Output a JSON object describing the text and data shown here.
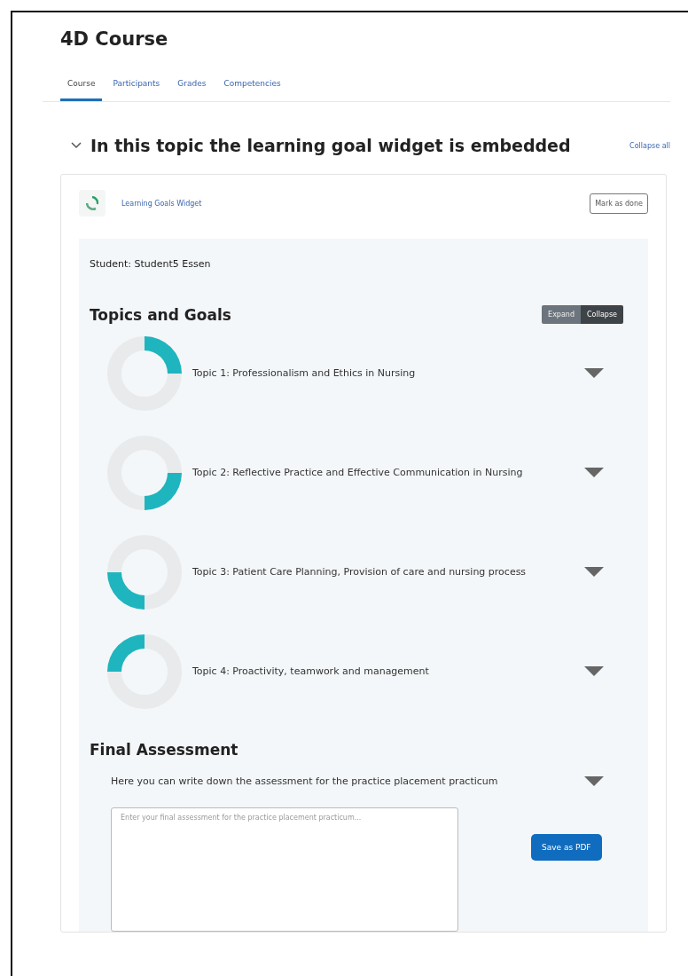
{
  "course_title": "4D Course",
  "tabs": [
    {
      "label": "Course",
      "selected": true
    },
    {
      "label": "Participants",
      "selected": false
    },
    {
      "label": "Grades",
      "selected": false
    },
    {
      "label": "Competencies",
      "selected": false
    }
  ],
  "section": {
    "title": "In this topic the learning goal widget is embedded",
    "expanded": true,
    "collapse_all": "Collapse all"
  },
  "activity": {
    "name": "Learning Goals Widget",
    "mark_button": "Mark as done"
  },
  "student": "Student: Student5 Essen",
  "topics_heading": "Topics and Goals",
  "toggle_buttons": [
    {
      "label": "Expand",
      "selected": false
    },
    {
      "label": "Collapse",
      "selected": true
    }
  ],
  "topics": [
    {
      "title": "Topic 1: Professionalism and Ethics in Nursing",
      "kind": "ne"
    },
    {
      "title": "Topic 2: Reflective Practice and Effective Communication in Nursing",
      "kind": "se"
    },
    {
      "title": "Topic 3: Patient Care Planning, Provision of care and nursing process",
      "kind": "sw"
    },
    {
      "title": "Topic 4: Proactivity, teamwork and management",
      "kind": "nw"
    }
  ],
  "final": {
    "heading": "Final Assessment",
    "text": "Here you can write down the assessment for the practice placement practicum",
    "placeholder": "Enter your final assessment for the practice placement practicum...",
    "save_button": "Save as PDF"
  }
}
